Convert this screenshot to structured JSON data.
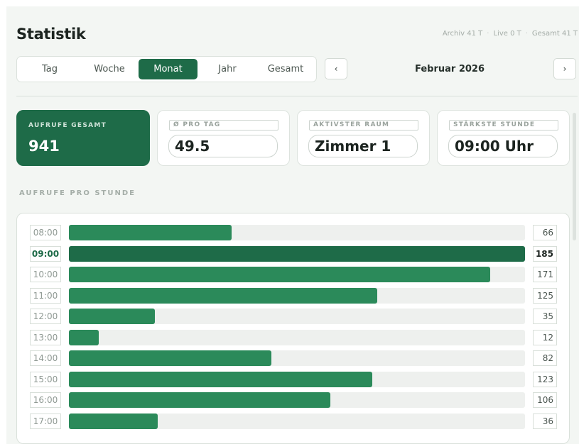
{
  "header": {
    "title": "Statistik",
    "meta": [
      {
        "label": "Archiv 41 T"
      },
      {
        "label": "Live 0 T"
      },
      {
        "label": "Gesamt 41 T"
      }
    ]
  },
  "periods": [
    {
      "label": "Tag"
    },
    {
      "label": "Woche"
    },
    {
      "label": "Monat"
    },
    {
      "label": "Jahr"
    },
    {
      "label": "Gesamt"
    }
  ],
  "active_period": "Monat",
  "date_nav": {
    "prev_label": "‹",
    "current": "Februar 2026",
    "next_label": "›"
  },
  "cards": [
    {
      "label": "AUFRUFE GESAMT",
      "value": "941"
    },
    {
      "label": "Ø PRO TAG",
      "value": "49.5"
    },
    {
      "label": "AKTIVSTER RAUM",
      "value": "Zimmer 1"
    },
    {
      "label": "STÄRKSTE STUNDE",
      "value": "09:00 Uhr"
    }
  ],
  "chart_data": {
    "type": "bar",
    "title": "AUFRUFE PRO STUNDE",
    "orientation": "horizontal",
    "categories": [
      "08:00",
      "09:00",
      "10:00",
      "11:00",
      "12:00",
      "13:00",
      "14:00",
      "15:00",
      "16:00",
      "17:00"
    ],
    "values": [
      66,
      185,
      171,
      125,
      35,
      12,
      82,
      123,
      106,
      36
    ],
    "value_labels": [
      "66",
      "185",
      "171",
      "125",
      "35",
      "12",
      "82",
      "123",
      "106",
      "36"
    ],
    "max": 185,
    "highlight": "09:00"
  },
  "colors": {
    "accent": "#1e6b48",
    "bar": "#2b8a5a",
    "track": "#eef0ee",
    "panel": "#f3f6f3"
  }
}
